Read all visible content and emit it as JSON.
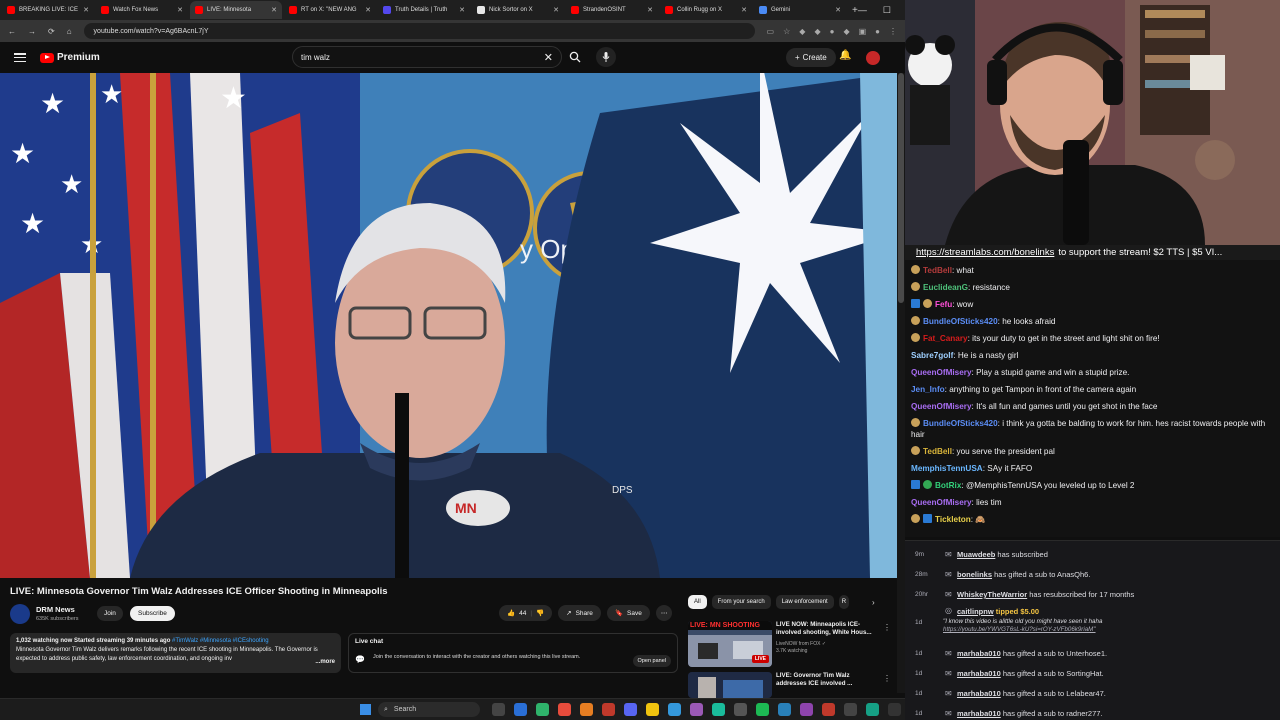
{
  "browser": {
    "tabs": [
      {
        "title": "BREAKING LIVE: ICE",
        "color": "#ff0000"
      },
      {
        "title": "Watch Fox News",
        "color": "#ff0000"
      },
      {
        "title": "LIVE: Minnesota",
        "color": "#ff0000"
      },
      {
        "title": "RT on X: \"NEW ANG",
        "color": "#ff0000"
      },
      {
        "title": "Truth Details | Truth",
        "color": "#5448ee"
      },
      {
        "title": "Nick Sortor on X",
        "color": "#e7e7e7"
      },
      {
        "title": "StrandenOSINT",
        "color": "#ff0000"
      },
      {
        "title": "Collin Rugg on X",
        "color": "#ff0000"
      },
      {
        "title": "Gemini",
        "color": "#4a8af4"
      }
    ],
    "active_tab": 2,
    "new_tab": "+",
    "url": "youtube.com/watch?v=Ag6BAcnL7jY"
  },
  "youtube": {
    "logo_label": "Premium",
    "search_value": "tim walz",
    "create_label": "Create",
    "video": {
      "title": "LIVE: Minnesota Governor Tim Walz Addresses ICE Officer Shooting in Minneapolis",
      "channel": "DRM News",
      "subscribers": "635K subscribers",
      "join_label": "Join",
      "subscribe_label": "Subscribe",
      "likes": "44",
      "share_label": "Share",
      "save_label": "Save",
      "podium_badge": "DPS",
      "description": {
        "meta": "1,032 watching now  Started streaming 39 minutes ago",
        "tags": " #TimWalz #Minnesota #ICEshooting",
        "text": "Minnesota Governor Tim Walz delivers remarks following the recent ICE shooting in Minneapolis. The Governor is expected to address public safety, law enforcement coordination, and ongoing inv",
        "more_label": "...more"
      }
    },
    "live_chat": {
      "title": "Live chat",
      "message": "Join the conversation to interact with the creator and others watching this live stream.",
      "open_panel_label": "Open panel"
    },
    "chips": [
      "All",
      "From your search",
      "Law enforcement",
      "R"
    ],
    "related": [
      {
        "thumb_text": "LIVE: MN SHOOTING",
        "title": "LIVE NOW: Minneapolis ICE-involved shooting, White Hous...",
        "channel": "LiveNOW from FOX ✓",
        "meta": "3.7K watching",
        "badge": "LIVE"
      },
      {
        "thumb_text": "",
        "title": "LIVE: Governor Tim Walz addresses ICE involved ...",
        "channel": "",
        "meta": "",
        "badge": ""
      }
    ]
  },
  "taskbar": {
    "search_label": "Search"
  },
  "stream": {
    "banner_link": "https://streamlabs.com/bonelinks",
    "banner_text": "to support the stream! $2 TTS | $5 VI..."
  },
  "chat": [
    {
      "badges": [
        "gold"
      ],
      "user": "TedBell",
      "color": "#b33b3b",
      "text": "what"
    },
    {
      "badges": [
        "gold"
      ],
      "user": "EuclideanG",
      "color": "#4ec07a",
      "text": "resistance"
    },
    {
      "badges": [
        "blue",
        "gold"
      ],
      "user": "Fefu",
      "color": "#ff4fd8",
      "text": "wow"
    },
    {
      "badges": [
        "gold"
      ],
      "user": "BundleOfSticks420",
      "color": "#5b8df5",
      "text": "he looks afraid"
    },
    {
      "badges": [
        "gold"
      ],
      "user": "Fat_Canary",
      "color": "#d61c1c",
      "text": "its your duty to get in the street and light shit on fire!"
    },
    {
      "badges": [],
      "user": "Sabre7golf",
      "color": "#9fd0ff",
      "text": "He is a nasty girl"
    },
    {
      "badges": [],
      "user": "QueenOfMisery",
      "color": "#a86df2",
      "text": "Play a stupid game and win a stupid prize."
    },
    {
      "badges": [],
      "user": "Jen_Info",
      "color": "#5b8df5",
      "text": "anything to get Tampon in front of the camera again"
    },
    {
      "badges": [],
      "user": "QueenOfMisery",
      "color": "#a86df2",
      "text": "It's all fun and games until you get shot in the face"
    },
    {
      "badges": [
        "gold"
      ],
      "user": "BundleOfSticks420",
      "color": "#5b8df5",
      "text": "i think ya gotta be balding to work for him. hes racist towards people with hair"
    },
    {
      "badges": [
        "gold"
      ],
      "user": "TedBell",
      "color": "#d8b43a",
      "text": "you serve the president pal"
    },
    {
      "badges": [],
      "user": "MemphisTennUSA",
      "color": "#6ab7ff",
      "text": "SAy it FAFO"
    },
    {
      "badges": [
        "blue",
        "green"
      ],
      "user": "BotRix",
      "color": "#33d17a",
      "text": "@MemphisTennUSA you leveled up to Level 2"
    },
    {
      "badges": [],
      "user": "QueenOfMisery",
      "color": "#a86df2",
      "text": "lies tim"
    },
    {
      "badges": [
        "gold",
        "blue"
      ],
      "user": "Tickleton",
      "color": "#e8d04a",
      "text": "🙈"
    }
  ],
  "events": [
    {
      "time": "9m",
      "user": "Muawdeeb",
      "text": " has subscribed"
    },
    {
      "time": "28m",
      "user": "bonelinks",
      "text": " has gifted a sub to AnasQh6."
    },
    {
      "time": "20hr",
      "user": "WhiskeyTheWarrior",
      "text": " has resubscribed for 17 months"
    },
    {
      "time": "1d",
      "user": "caitlinpnw",
      "text": " tipped $5.00",
      "tip": true,
      "quote": "\"I know this video is alittle old you might have seen it haha",
      "link": "https://youtu.be/YWVGT6sL-kU?si=rOY-zVFb06k9riaM\""
    },
    {
      "time": "1d",
      "user": "marhaba010",
      "text": " has gifted a sub to Unterhose1."
    },
    {
      "time": "1d",
      "user": "marhaba010",
      "text": " has gifted a sub to SortingHat."
    },
    {
      "time": "1d",
      "user": "marhaba010",
      "text": " has gifted a sub to Lelabear47."
    },
    {
      "time": "1d",
      "user": "marhaba010",
      "text": " has gifted a sub to radner277."
    }
  ]
}
